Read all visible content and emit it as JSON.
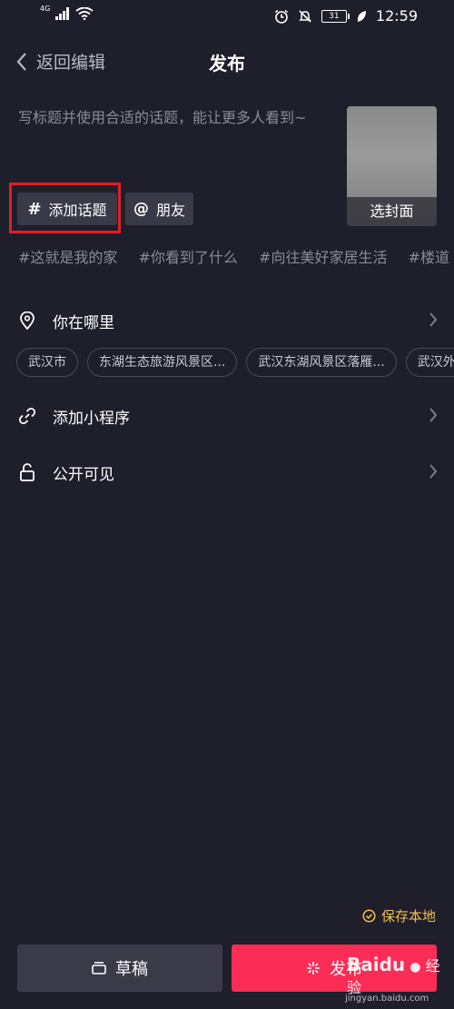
{
  "status_bar": {
    "network": "4G",
    "battery": "31",
    "time": "12:59",
    "icons": [
      "signal-icon",
      "wifi-icon",
      "alarm-icon",
      "mute-icon",
      "battery-icon",
      "leaf-icon"
    ]
  },
  "nav": {
    "back_label": "返回编辑",
    "title": "发布"
  },
  "caption_placeholder": "写标题并使用合适的话题，能让更多人看到~",
  "cover": {
    "label": "选封面"
  },
  "buttons": {
    "add_topic": "添加话题",
    "friends": "朋友",
    "hash_symbol": "#",
    "at_symbol": "@"
  },
  "hashtags": [
    "#这就是我的家",
    "#你看到了什么",
    "#向往美好家居生活",
    "#楼道"
  ],
  "location": {
    "label": "你在哪里",
    "suggestions": [
      "武汉市",
      "东湖生态旅游风景区...",
      "武汉东湖风景区落雁...",
      "武汉外"
    ]
  },
  "mini_program": {
    "label": "添加小程序"
  },
  "visibility": {
    "label": "公开可见"
  },
  "save_local": "保存本地",
  "footer": {
    "draft": "草稿",
    "publish": "发布"
  },
  "watermark": {
    "brand": "Baidu",
    "suffix": "经验",
    "url": "jingyan.baidu.com"
  },
  "colors": {
    "background": "#1f1e2b",
    "publish_button": "#fb2c55",
    "highlight_outline": "#e0202a",
    "save_local": "#f2c14e"
  }
}
